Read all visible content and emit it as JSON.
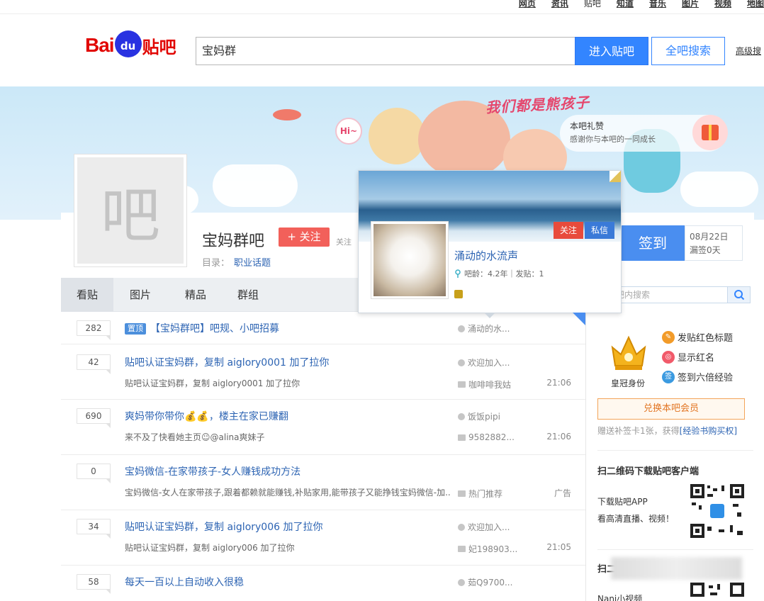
{
  "topnav": {
    "links": [
      "网页",
      "资讯",
      "贴吧",
      "知道",
      "音乐",
      "图片",
      "视频",
      "地图"
    ]
  },
  "logo": {
    "bai": "Bai",
    "du": "du",
    "tieba": "贴吧"
  },
  "search": {
    "value": "宝妈群",
    "enter_label": "进入贴吧",
    "all_label": "全吧搜索",
    "advanced_label": "高级搜"
  },
  "banner": {
    "slogan": "我们都是熊孩子",
    "gift_title": "本吧礼赞",
    "gift_desc": "感谢你与本吧的一同成长",
    "hi": "Hi~"
  },
  "forum": {
    "avatar_char": "吧",
    "name": "宝妈群吧",
    "follow_label": "+ 关注",
    "follow_suffix": "关注",
    "catalog_label": "目录：",
    "catalog_value": "职业话题",
    "signin_label": "签到",
    "sign_date": "08月22日",
    "sign_missed": "漏签0天"
  },
  "tabs": [
    "看贴",
    "图片",
    "精品",
    "群组"
  ],
  "in_search": {
    "placeholder": "吧内搜索"
  },
  "popup": {
    "name": "涌动的水流声",
    "follow_label": "关注",
    "msg_label": "私信",
    "meta": "吧龄：4.2年｜发贴：1"
  },
  "threads": [
    {
      "count": "282",
      "tag": "置顶",
      "title": "【宝妈群吧】吧规、小吧招募",
      "author": "涌动的水...",
      "desc": "",
      "last": "",
      "time": ""
    },
    {
      "count": "42",
      "tag": "",
      "title": "贴吧认证宝妈群，复制 aiglory0001 加了拉你",
      "author": "欢迎加入...",
      "desc": "贴吧认证宝妈群，复制 aiglory0001 加了拉你",
      "last": "咖啡啡我姑",
      "time": "21:06"
    },
    {
      "count": "690",
      "tag": "",
      "title": "爽妈带你带你💰💰，楼主在家已赚翻",
      "author": "饭饭pipi",
      "desc": "来不及了快看她主页☺@alina爽妹子",
      "last": "9582882...",
      "time": "21:06"
    },
    {
      "count": "0",
      "tag": "",
      "title": "宝妈微信-在家带孩子-女人赚钱成功方法",
      "author": "",
      "desc": "宝妈微信-女人在家带孩子,跟着都赖就能赚钱,补贴家用,能带孩子又能挣钱宝妈微信-加..",
      "last": "热门推荐",
      "time": "广告"
    },
    {
      "count": "34",
      "tag": "",
      "title": "贴吧认证宝妈群，复制 aiglory006 加了拉你",
      "author": "欢迎加入...",
      "desc": "贴吧认证宝妈群，复制 aiglory006 加了拉你",
      "last": "妃198903...",
      "time": "21:05"
    },
    {
      "count": "58",
      "tag": "",
      "title": "每天一百以上自动收入很稳",
      "author": "茹Q9700...",
      "desc": "",
      "last": "",
      "time": ""
    }
  ],
  "sidebar": {
    "crown_label": "皇冠身份",
    "perks": [
      "发贴红色标题",
      "显示红名",
      "签到六倍经验"
    ],
    "exchange_label": "兑换本吧会员",
    "bonus_text": "赠送补签卡1张，获得",
    "bonus_link": "[经验书购买权]",
    "qr_title": "扫二维码下载贴吧客户端",
    "qr_line1": "下载贴吧APP",
    "qr_line2": "看高清直播、视频！",
    "qr2_title": "扫二",
    "qr2_line": "Nani小视频"
  },
  "colors": {
    "brand_red": "#e10602",
    "brand_blue": "#2932e1",
    "accent_blue": "#3385ff",
    "link_blue": "#2d64b3",
    "follow_red": "#f2605a"
  }
}
